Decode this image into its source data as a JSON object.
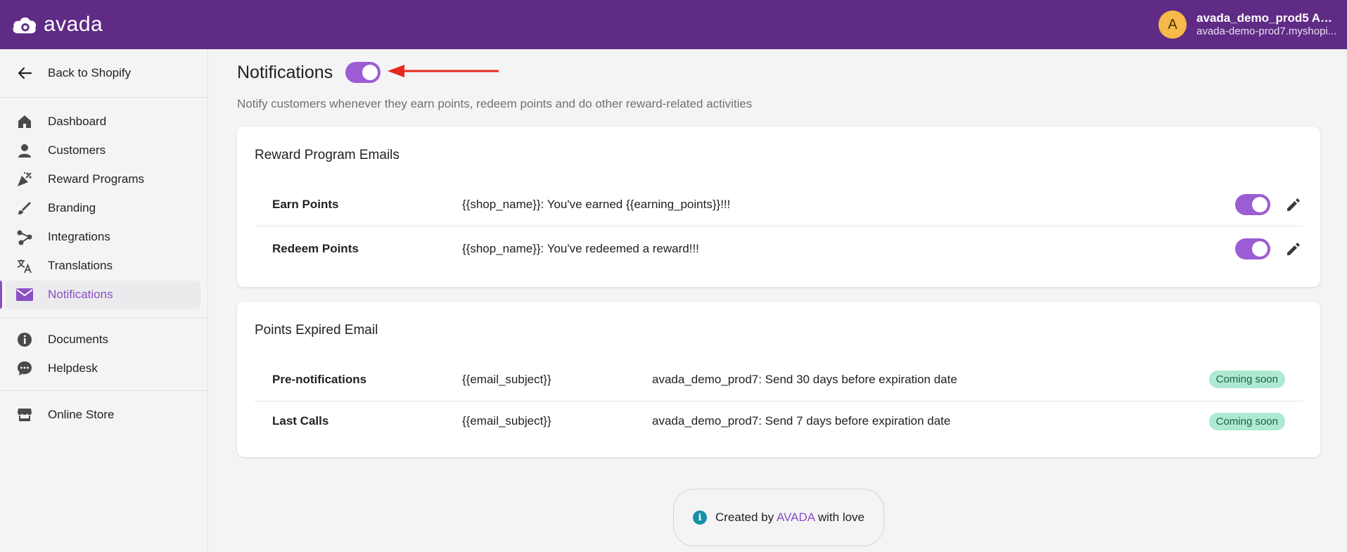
{
  "topbar": {
    "logo_text": "avada",
    "avatar_letter": "A",
    "account_name": "avada_demo_prod5 Ad...",
    "account_shop": "avada-demo-prod7.myshopi..."
  },
  "sidebar": {
    "back": "Back to Shopify",
    "items": [
      {
        "label": "Dashboard",
        "icon": "home-icon"
      },
      {
        "label": "Customers",
        "icon": "person-icon"
      },
      {
        "label": "Reward Programs",
        "icon": "party-popper-icon"
      },
      {
        "label": "Branding",
        "icon": "brush-icon"
      },
      {
        "label": "Integrations",
        "icon": "share-nodes-icon"
      },
      {
        "label": "Translations",
        "icon": "translate-icon"
      },
      {
        "label": "Notifications",
        "icon": "mail-icon",
        "active": true
      }
    ],
    "secondary": [
      {
        "label": "Documents",
        "icon": "info-icon"
      },
      {
        "label": "Helpdesk",
        "icon": "chat-icon"
      }
    ],
    "store": {
      "label": "Online Store",
      "icon": "store-icon"
    }
  },
  "main": {
    "title": "Notifications",
    "subtitle": "Notify customers whenever they earn points, redeem points and do other reward-related activities",
    "master_toggle_on": true
  },
  "reward_emails": {
    "title": "Reward Program Emails",
    "rows": [
      {
        "name": "Earn Points",
        "subject": "{{shop_name}}: You've earned {{earning_points}}!!!",
        "enabled": true
      },
      {
        "name": "Redeem Points",
        "subject": "{{shop_name}}: You've redeemed a reward!!!",
        "enabled": true
      }
    ]
  },
  "expired_emails": {
    "title": "Points Expired Email",
    "rows": [
      {
        "name": "Pre-notifications",
        "subject": "{{email_subject}}",
        "desc": "avada_demo_prod7: Send 30 days before expiration date",
        "badge": "Coming soon"
      },
      {
        "name": "Last Calls",
        "subject": "{{email_subject}}",
        "desc": "avada_demo_prod7: Send 7 days before expiration date",
        "badge": "Coming soon"
      }
    ]
  },
  "footer": {
    "prefix": "Created by",
    "brand": "AVADA",
    "suffix": "with love"
  },
  "colors": {
    "topbar": "#5f2b85",
    "accent": "#9c5cd4",
    "badge_bg": "#aee9d1",
    "arrow": "#e8281f"
  }
}
